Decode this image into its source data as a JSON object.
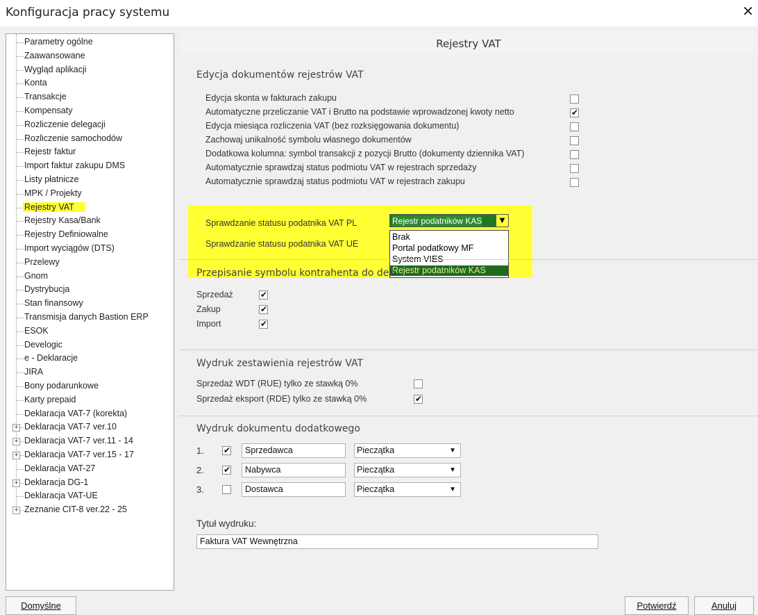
{
  "window": {
    "title": "Konfiguracja pracy systemu",
    "close_icon": "close-icon"
  },
  "tree": {
    "items": [
      {
        "label": "Parametry ogólne"
      },
      {
        "label": "Zaawansowane"
      },
      {
        "label": "Wygląd aplikacji"
      },
      {
        "label": "Konta"
      },
      {
        "label": "Transakcje"
      },
      {
        "label": "Kompensaty"
      },
      {
        "label": "Rozliczenie delegacji"
      },
      {
        "label": "Rozliczenie samochodów"
      },
      {
        "label": "Rejestr faktur"
      },
      {
        "label": "Import faktur zakupu DMS"
      },
      {
        "label": "Listy płatnicze"
      },
      {
        "label": "MPK / Projekty"
      },
      {
        "label": "Rejestry VAT",
        "selected": true
      },
      {
        "label": "Rejestry Kasa/Bank"
      },
      {
        "label": "Rejestry Definiowalne"
      },
      {
        "label": "Import wyciągów (DTS)"
      },
      {
        "label": "Przelewy"
      },
      {
        "label": "Gnom"
      },
      {
        "label": "Dystrybucja"
      },
      {
        "label": "Stan finansowy"
      },
      {
        "label": "Transmisja danych Bastion ERP"
      },
      {
        "label": "ESOK"
      },
      {
        "label": "Develogic"
      },
      {
        "label": "e - Deklaracje"
      },
      {
        "label": "JIRA"
      },
      {
        "label": "Bony podarunkowe"
      },
      {
        "label": "Karty prepaid"
      },
      {
        "label": "Deklaracja VAT-7 (korekta)"
      },
      {
        "label": "Deklaracja VAT-7 ver.10",
        "expandable": true
      },
      {
        "label": "Deklaracja VAT-7 ver.11 - 14",
        "expandable": true
      },
      {
        "label": "Deklaracja VAT-7 ver.15 - 17",
        "expandable": true
      },
      {
        "label": "Deklaracja VAT-27"
      },
      {
        "label": "Deklaracja DG-1",
        "expandable": true
      },
      {
        "label": "Deklaracja VAT-UE"
      },
      {
        "label": "Zeznanie CIT-8 ver.22 - 25",
        "expandable": true
      }
    ],
    "expander_symbol": "+"
  },
  "main": {
    "title": "Rejestry VAT",
    "group1": {
      "title": "Edycja dokumentów rejestrów VAT",
      "rows": [
        {
          "label": "Edycja skonta w fakturach zakupu",
          "checked": false
        },
        {
          "label": "Automatyczne przeliczanie VAT i Brutto na podstawie wprowadzonej kwoty netto",
          "checked": true
        },
        {
          "label": "Edycja miesiąca rozliczenia VAT (bez rozksięgowania dokumentu)",
          "checked": false
        },
        {
          "label": "Zachowaj unikalność symbolu własnego dokumentów",
          "checked": false
        },
        {
          "label": "Dodatkowa kolumna: symbol transakcji z pozycji Brutto (dokumenty dziennika VAT)",
          "checked": false
        },
        {
          "label": "Automatycznie sprawdzaj status podmiotu VAT w rejestrach sprzedaży",
          "checked": false
        },
        {
          "label": "Automatycznie sprawdzaj status podmiotu VAT w rejestrach zakupu",
          "checked": false
        }
      ],
      "status_pl_label": "Sprawdzanie statusu podatnika VAT PL",
      "status_ue_label": "Sprawdzanie statusu podatnika VAT UE",
      "status_pl_value": "Rejestr podatników KAS",
      "dropdown_options": [
        {
          "label": "Brak"
        },
        {
          "label": "Portal podatkowy MF"
        },
        {
          "label": "System VIES"
        },
        {
          "label": "Rejestr podatników KAS",
          "selected": true
        }
      ]
    },
    "group2": {
      "title": "Przepisanie symbolu kontrahenta do dek",
      "rows": [
        {
          "label": "Sprzedaż",
          "checked": true
        },
        {
          "label": "Zakup",
          "checked": true
        },
        {
          "label": "Import",
          "checked": true
        }
      ]
    },
    "group3": {
      "title": "Wydruk zestawienia rejestrów VAT",
      "rows": [
        {
          "label": "Sprzedaż WDT (RUE) tylko ze stawką 0%",
          "checked": false
        },
        {
          "label": "Sprzedaż eksport (RDE) tylko ze stawką 0%",
          "checked": true
        }
      ]
    },
    "group4": {
      "title": "Wydruk dokumentu dodatkowego",
      "rows": [
        {
          "num": "1.",
          "checked": true,
          "name": "Sprzedawca",
          "stamp": "Pieczątka"
        },
        {
          "num": "2.",
          "checked": true,
          "name": "Nabywca",
          "stamp": "Pieczątka"
        },
        {
          "num": "3.",
          "checked": false,
          "name": "Dostawca",
          "stamp": "Pieczątka"
        }
      ],
      "print_title_label": "Tytuł wydruku:",
      "print_title_value": "Faktura VAT Wewnętrzna"
    }
  },
  "buttons": {
    "default": "Domyślne",
    "confirm": "Potwierdź",
    "cancel": "Anuluj"
  },
  "glyphs": {
    "check": "✔",
    "dropdown_arrow": "▼"
  },
  "colors": {
    "highlight": "#ffff33",
    "combo_bg": "#1f7a1f"
  }
}
